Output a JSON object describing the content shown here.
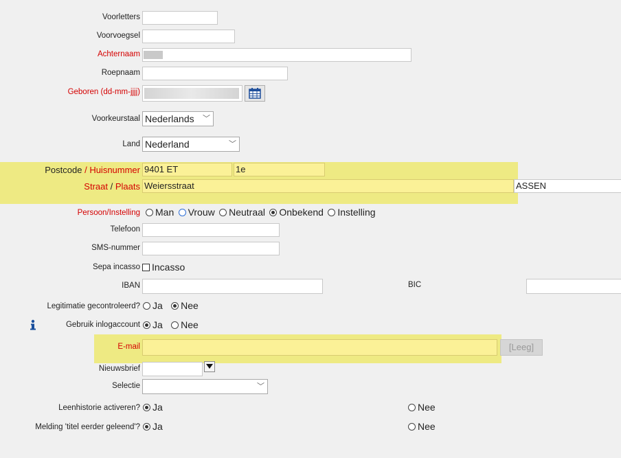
{
  "labels": {
    "voorletters": "Voorletters",
    "voorvoegsel": "Voorvoegsel",
    "achternaam": "Achternaam",
    "roepnaam": "Roepnaam",
    "geboren": "Geboren (dd-mm-jjjj)",
    "voorkeurstaal": "Voorkeurstaal",
    "land": "Land",
    "postcode": "Postcode",
    "slash": "/",
    "huisnummer": "Huisnummer",
    "straat": "Straat",
    "plaats": "Plaats",
    "persoon": "Persoon/Instelling",
    "telefoon": "Telefoon",
    "sms": "SMS-nummer",
    "sepa": "Sepa incasso",
    "iban": "IBAN",
    "bic": "BIC",
    "legitimatie": "Legitimatie gecontroleerd?",
    "inlog": "Gebruik inlogaccount",
    "email": "E-mail",
    "nieuwsbrief": "Nieuwsbrief",
    "selectie": "Selectie",
    "leenhistorie": "Leenhistorie activeren?",
    "melding": "Melding 'titel eerder geleend'?"
  },
  "values": {
    "voorkeurstaal": "Nederlands",
    "land": "Nederland",
    "postcode": "9401 ET",
    "huisnummer": "1e",
    "straat": "Weiersstraat",
    "plaats": "ASSEN",
    "email_button": "[Leeg]"
  },
  "options": {
    "persoon": [
      "Man",
      "Vrouw",
      "Neutraal",
      "Onbekend",
      "Instelling"
    ],
    "persoon_selected": "Onbekend",
    "incasso": "Incasso",
    "ja": "Ja",
    "nee": "Nee"
  },
  "colors": {
    "required": "#d40000",
    "highlight": "#ede85f",
    "field_yellow": "#fbf197"
  },
  "icons": {
    "calendar": "calendar-icon",
    "info": "info-icon",
    "dropdown": "chevron-down-icon"
  }
}
